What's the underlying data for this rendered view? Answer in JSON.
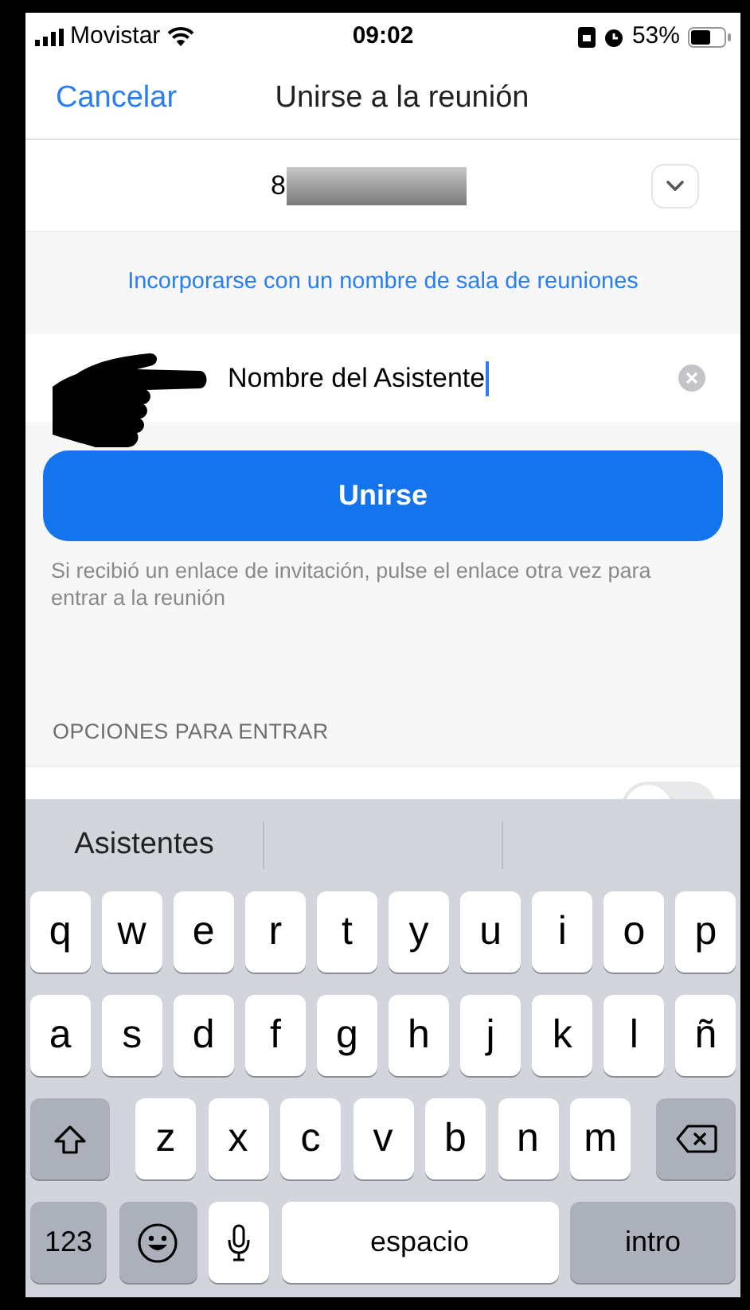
{
  "status_bar": {
    "carrier": "Movistar",
    "time": "09:02",
    "battery": "53%"
  },
  "nav": {
    "cancel": "Cancelar",
    "title": "Unirse a la reunión"
  },
  "meeting_id": {
    "value": "8"
  },
  "room_name_link": "Incorporarse con un nombre de sala de reuniones",
  "name_field": {
    "value": "Nombre del Asistente"
  },
  "join_button": "Unirse",
  "hint": "Si recibió un enlace de invitación, pulse el enlace otra vez para entrar a la reunión",
  "section_header": "OPCIONES PARA ENTRAR",
  "option_toggle": {
    "on": false
  },
  "keyboard": {
    "suggestions": [
      "Asistentes"
    ],
    "rows": [
      {
        "keys": [
          {
            "kind": "letter",
            "label": "q"
          },
          {
            "kind": "letter",
            "label": "w"
          },
          {
            "kind": "letter",
            "label": "e"
          },
          {
            "kind": "letter",
            "label": "r"
          },
          {
            "kind": "letter",
            "label": "t"
          },
          {
            "kind": "letter",
            "label": "y"
          },
          {
            "kind": "letter",
            "label": "u"
          },
          {
            "kind": "letter",
            "label": "i"
          },
          {
            "kind": "letter",
            "label": "o"
          },
          {
            "kind": "letter",
            "label": "p"
          }
        ]
      },
      {
        "keys": [
          {
            "kind": "letter",
            "label": "a"
          },
          {
            "kind": "letter",
            "label": "s"
          },
          {
            "kind": "letter",
            "label": "d"
          },
          {
            "kind": "letter",
            "label": "f"
          },
          {
            "kind": "letter",
            "label": "g"
          },
          {
            "kind": "letter",
            "label": "h"
          },
          {
            "kind": "letter",
            "label": "j"
          },
          {
            "kind": "letter",
            "label": "k"
          },
          {
            "kind": "letter",
            "label": "l"
          },
          {
            "kind": "letter",
            "label": "ñ"
          }
        ]
      },
      {
        "keys": [
          {
            "kind": "shift"
          },
          {
            "kind": "letter",
            "label": "z"
          },
          {
            "kind": "letter",
            "label": "x"
          },
          {
            "kind": "letter",
            "label": "c"
          },
          {
            "kind": "letter",
            "label": "v"
          },
          {
            "kind": "letter",
            "label": "b"
          },
          {
            "kind": "letter",
            "label": "n"
          },
          {
            "kind": "letter",
            "label": "m"
          },
          {
            "kind": "delete"
          }
        ]
      },
      {
        "keys": [
          {
            "kind": "mode",
            "label": "123"
          },
          {
            "kind": "emoji"
          },
          {
            "kind": "mic"
          },
          {
            "kind": "space",
            "label": "espacio"
          },
          {
            "kind": "return",
            "label": "intro"
          }
        ]
      }
    ]
  }
}
